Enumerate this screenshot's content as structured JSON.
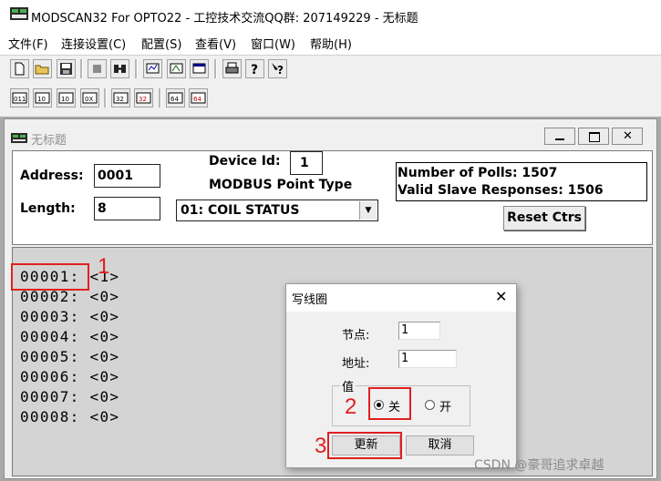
{
  "app": {
    "title": "MODSCAN32 For OPTO22 - 工控技术交流QQ群: 207149229 - 无标题"
  },
  "menu": [
    "文件(F)",
    "连接设置(C)",
    "配置(S)",
    "查看(V)",
    "窗口(W)",
    "帮助(H)"
  ],
  "toolbar1": [
    "new-file-icon",
    "open-folder-icon",
    "save-disk-icon",
    "stop-icon",
    "connect-icon",
    "poll-icon",
    "display-icon",
    "window-icon",
    "print-icon",
    "help-icon",
    "context-help-icon"
  ],
  "toolbar2": {
    "buttons": [
      "011",
      "10",
      "10",
      "0X",
      "32",
      "32",
      "64",
      "64"
    ],
    "icons": [
      "binary-icon",
      "decimal-icon",
      "integer-icon",
      "hex-icon",
      "float32-icon",
      "float32-swap-icon",
      "double64-icon",
      "double64-swap-icon"
    ]
  },
  "child": {
    "title": "无标题",
    "address_label": "Address:",
    "address_value": "0001",
    "length_label": "Length:",
    "length_value": "8",
    "device_id_label": "Device Id:",
    "device_id_value": "1",
    "point_type_label": "MODBUS Point Type",
    "point_type_value": "01: COIL STATUS",
    "polls_label": "Number of Polls: 1507",
    "valid_label": "Valid Slave Responses: 1506",
    "reset_button": "Reset Ctrs"
  },
  "rows": [
    "00001: <1>",
    "00002: <0>",
    "00003: <0>",
    "00004: <0>",
    "00005: <0>",
    "00006: <0>",
    "00007: <0>",
    "00008: <0>"
  ],
  "dialog": {
    "title": "写线圈",
    "node_label": "节点:",
    "node_value": "1",
    "address_label": "地址:",
    "address_value": "1",
    "group_label": "值",
    "off_label": "关",
    "on_label": "开",
    "selected": "关",
    "update_button": "更新",
    "cancel_button": "取消"
  },
  "annotations": [
    "1",
    "2",
    "3"
  ],
  "watermark": "CSDN @豪哥追求卓越",
  "colors": {
    "annotation": "#e02020",
    "data_bg": "#d4d4d4",
    "mdi_bg": "#a9a9a9"
  }
}
